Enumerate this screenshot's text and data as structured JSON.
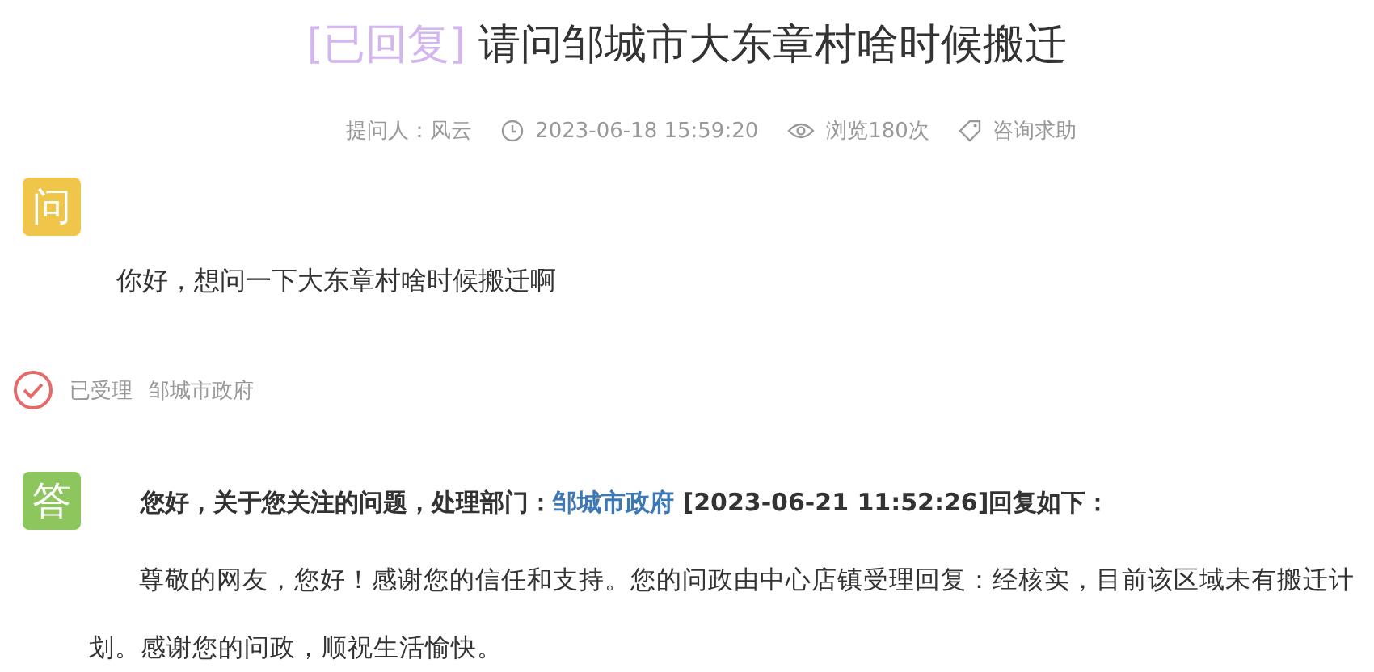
{
  "title": {
    "tag": "[已回复]",
    "text": "请问邹城市大东章村啥时候搬迁"
  },
  "meta": [
    {
      "kind": "person",
      "text": "提问人：风云"
    },
    {
      "kind": "time",
      "text": "2023-06-18 15:59:20"
    },
    {
      "kind": "views",
      "text": "浏览180次"
    },
    {
      "kind": "tag",
      "text": "咨询求助"
    }
  ],
  "question": {
    "badge": "问",
    "text": "你好，想问一下大东章村啥时候搬迁啊"
  },
  "status": {
    "label": "已受理",
    "department": "邹城市政府"
  },
  "answer": {
    "badge": "答",
    "heading_before": "您好，关于您关注的问题，处理部门：",
    "department_link": "邹城市政府",
    "heading_after": " [2023-06-21 11:52:26]回复如下：",
    "body": "尊敬的网友，您好！感谢您的信任和支持。您的问政由中心店镇受理回复：经核实，目前该区域未有搬迁计划。感谢您的问政，顺祝生活愉快。"
  }
}
